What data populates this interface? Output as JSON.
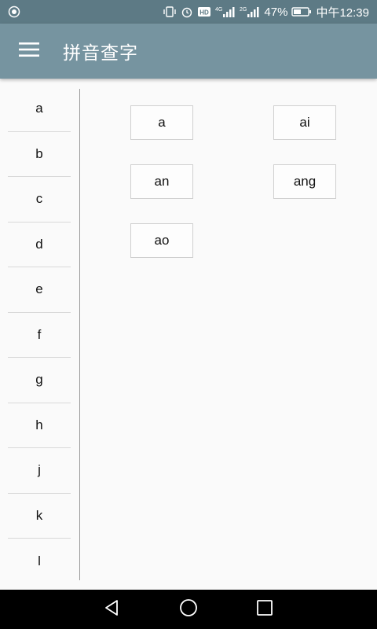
{
  "status_bar": {
    "network": "4G",
    "network2": "2G",
    "battery": "47%",
    "time": "中午12:39",
    "icons": [
      "notification-icon",
      "vibrate-icon",
      "alarm-icon",
      "hd-icon",
      "signal-icon",
      "signal-icon",
      "battery-icon"
    ]
  },
  "toolbar": {
    "title": "拼音查字",
    "menu_icon": "menu-icon"
  },
  "letters": [
    "a",
    "b",
    "c",
    "d",
    "e",
    "f",
    "g",
    "h",
    "j",
    "k",
    "l"
  ],
  "pinyin": [
    "a",
    "ai",
    "an",
    "ang",
    "ao"
  ],
  "nav": [
    "back-icon",
    "home-icon",
    "recents-icon"
  ]
}
